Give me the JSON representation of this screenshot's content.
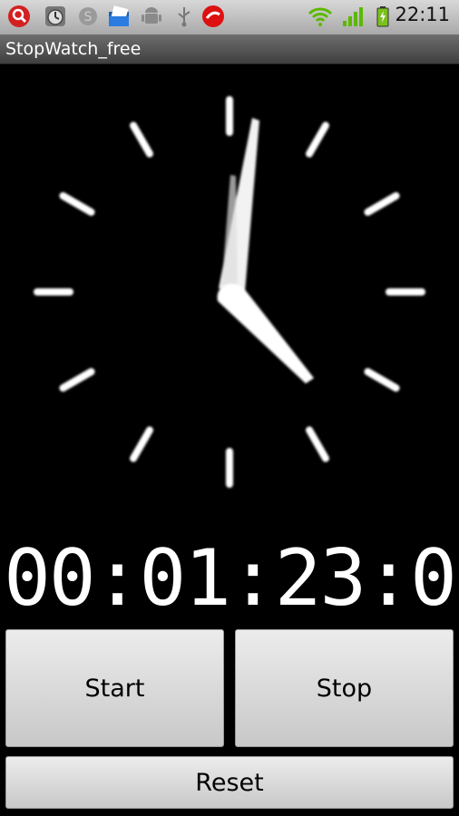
{
  "status_bar": {
    "time": "22:11",
    "icons_left": [
      "search-app-icon",
      "alarm-clock-icon",
      "skype-icon",
      "file-manager-icon",
      "android-debug-icon",
      "usb-icon",
      "trendmicro-icon"
    ],
    "icons_right": [
      "wifi-icon",
      "signal-icon",
      "battery-charging-icon"
    ]
  },
  "app": {
    "title": "StopWatch_free"
  },
  "stopwatch": {
    "readout": "00:01:23:0",
    "minutes": 1,
    "seconds": 23,
    "tenths": 0
  },
  "buttons": {
    "start": "Start",
    "stop": "Stop",
    "reset": "Reset"
  },
  "colors": {
    "background": "#000000",
    "hands": "#ffffff",
    "button_face": "#dcdcdc"
  }
}
